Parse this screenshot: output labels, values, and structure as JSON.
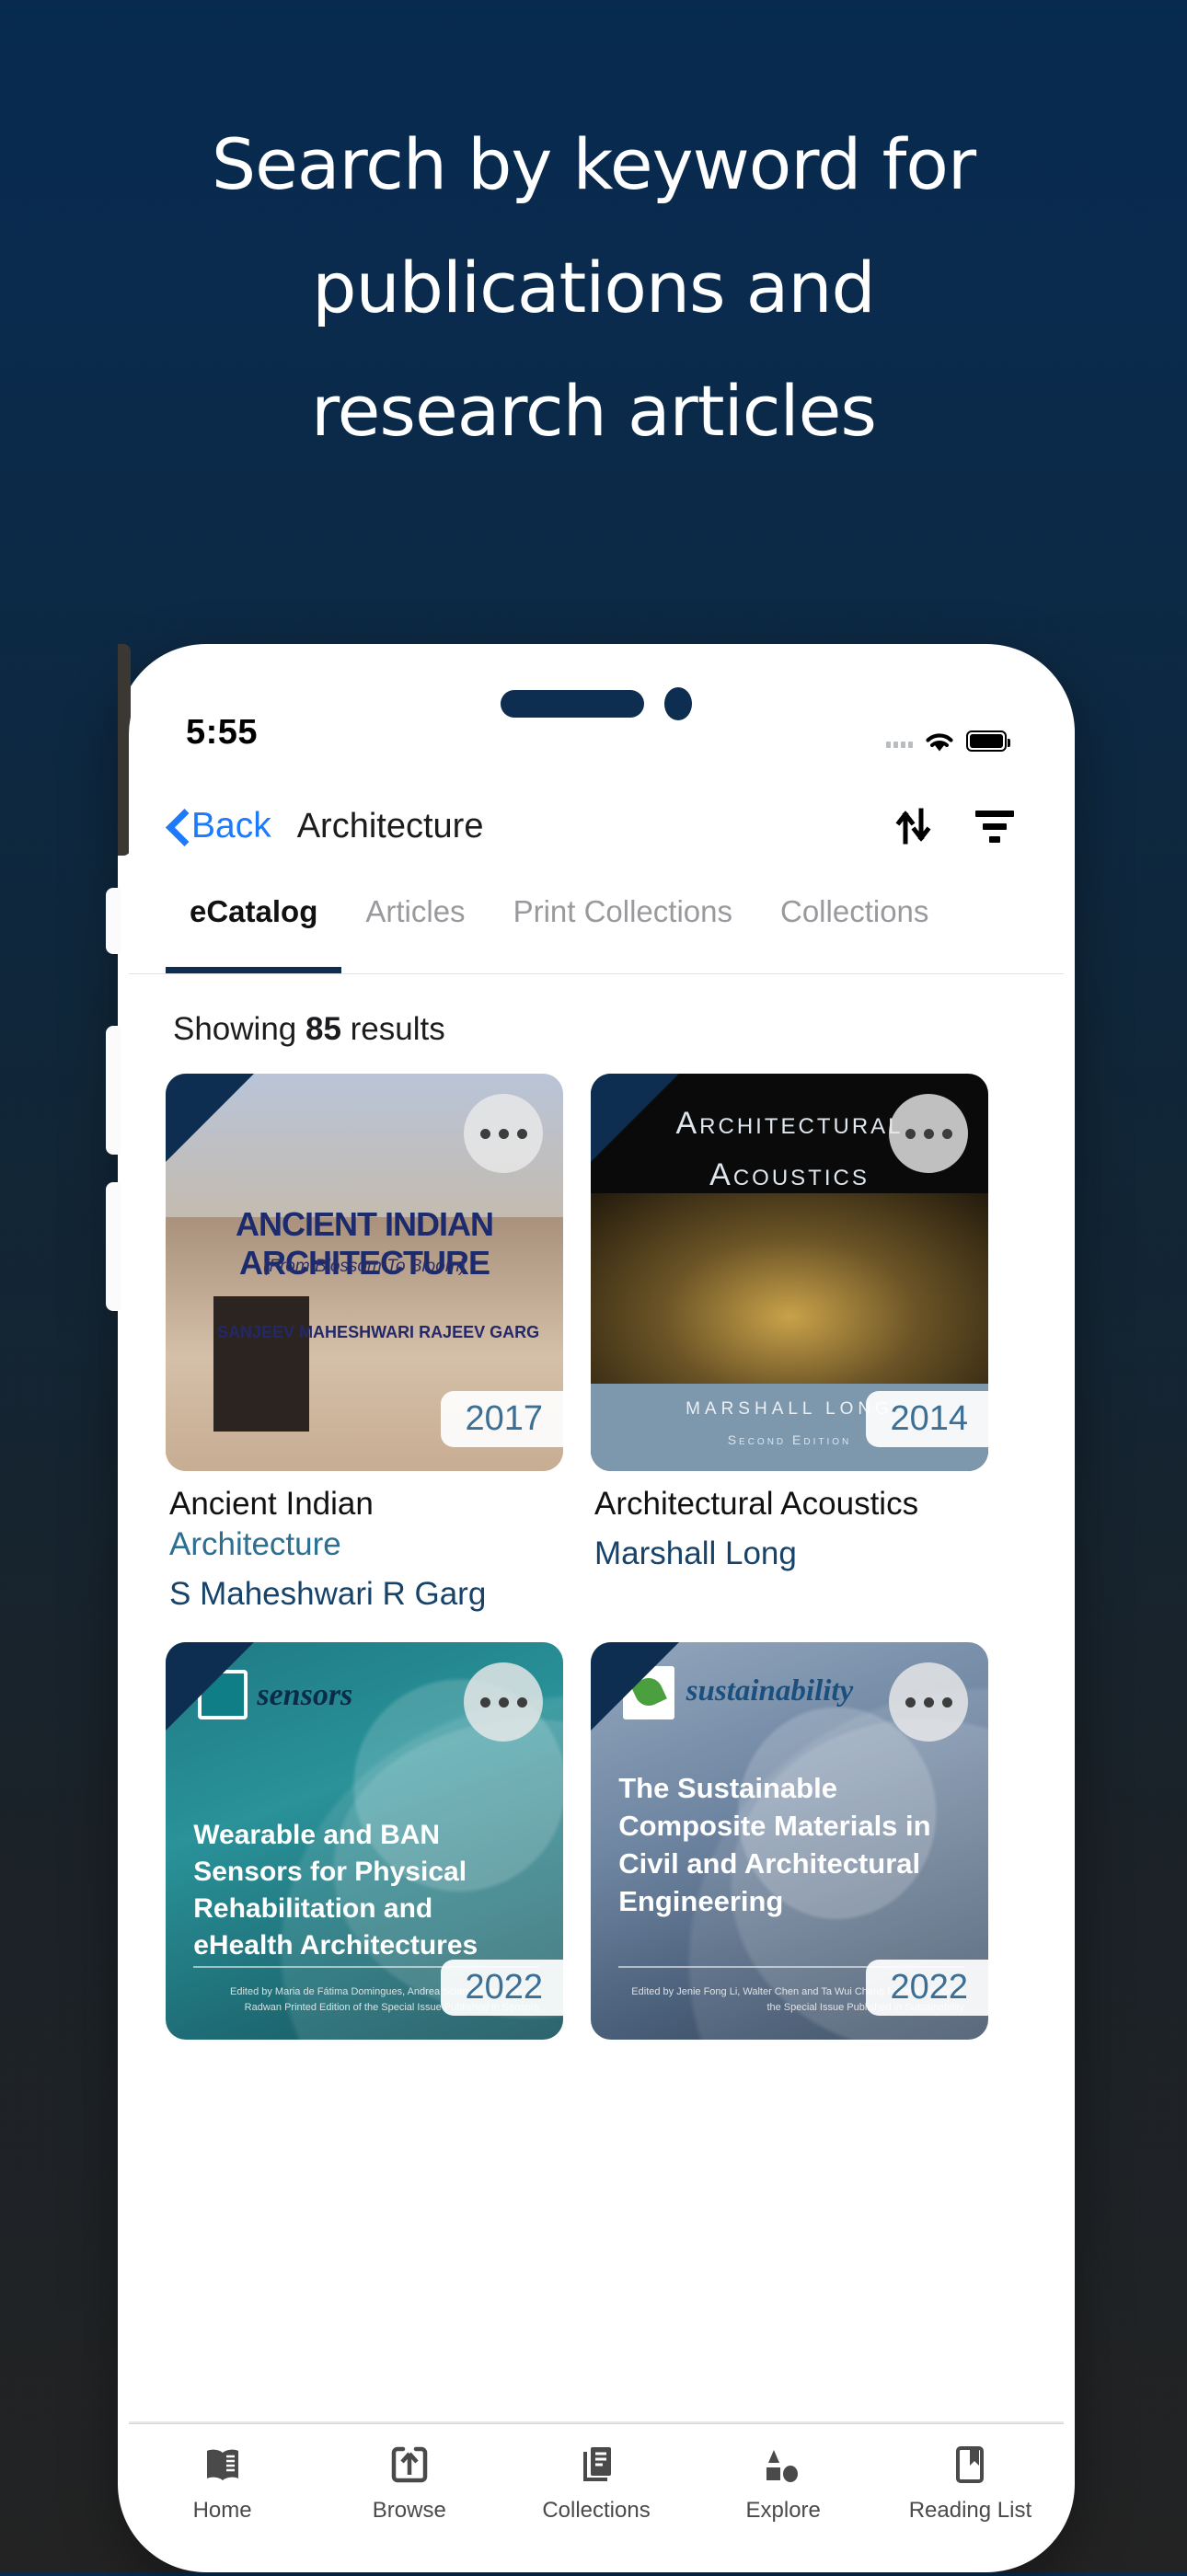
{
  "promo": {
    "headline_lines": [
      "Search by keyword for",
      "publications and",
      "research articles"
    ],
    "background_top_color": "#072a4f",
    "background_bottom_color": "#232323"
  },
  "statusbar": {
    "time": "5:55",
    "signal_icon": "signal-dots-icon",
    "wifi_icon": "wifi-icon",
    "battery_icon": "battery-full-icon"
  },
  "navbar": {
    "back_label": "Back",
    "title": "Architecture",
    "sort_icon": "sort-arrows-icon",
    "filter_icon": "filter-lines-icon",
    "accent_color": "#1d7afc"
  },
  "tabs": {
    "items": [
      {
        "label": "eCatalog",
        "active": true
      },
      {
        "label": "Articles",
        "active": false
      },
      {
        "label": "Print Collections",
        "active": false
      },
      {
        "label": "Collections",
        "active": false
      }
    ],
    "indicator_color": "#0d2d51"
  },
  "results": {
    "showing_prefix": "Showing ",
    "count": "85",
    "showing_suffix": " results",
    "cards": [
      {
        "title_plain": "Ancient Indian",
        "title_highlight": "Architecture",
        "author": "S Maheshwari R Garg",
        "year": "2017",
        "more_icon": "more-options-icon",
        "cover": {
          "line1": "ANCIENT INDIAN ARCHITECTURE",
          "line2": "(From Blossom To Bloom)",
          "line3": "SANJEEV MAHESHWARI\nRAJEEV GARG"
        }
      },
      {
        "title_plain": "Architectural Acoustics",
        "title_highlight": "",
        "author": "Marshall Long",
        "year": "2014",
        "more_icon": "more-options-icon",
        "cover": {
          "line1": "Architectural",
          "line2": "Acoustics",
          "line3": "MARSHALL LONG",
          "line4": "Second Edition"
        }
      },
      {
        "title_plain": "",
        "title_highlight": "",
        "author": "",
        "year": "2022",
        "more_icon": "more-options-icon",
        "cover": {
          "journal": "sensors",
          "title": "Wearable and BAN Sensors for Physical Rehabilitation and eHealth Architectures",
          "editors": "Edited by\nMaria de Fátima Domingues, Andrea Sciarrone and Ayman Radwan\nPrinted Edition of the Special Issue Published in Sensors"
        }
      },
      {
        "title_plain": "",
        "title_highlight": "",
        "author": "",
        "year": "2022",
        "more_icon": "more-options-icon",
        "cover": {
          "journal": "sustainability",
          "title": "The Sustainable Composite Materials in Civil and Architectural Engineering",
          "editors": "Edited by\nJenie Fong Li, Walter Chen and Ta Wui Cheng\nPrinted Edition of the Special Issue Published in Sustainability"
        }
      }
    ]
  },
  "tabbar": {
    "items": [
      {
        "label": "Home",
        "icon": "open-book-icon"
      },
      {
        "label": "Browse",
        "icon": "phone-upload-icon"
      },
      {
        "label": "Collections",
        "icon": "stacked-documents-icon"
      },
      {
        "label": "Explore",
        "icon": "shapes-icon"
      },
      {
        "label": "Reading\nList",
        "icon": "bookmark-icon"
      }
    ]
  }
}
